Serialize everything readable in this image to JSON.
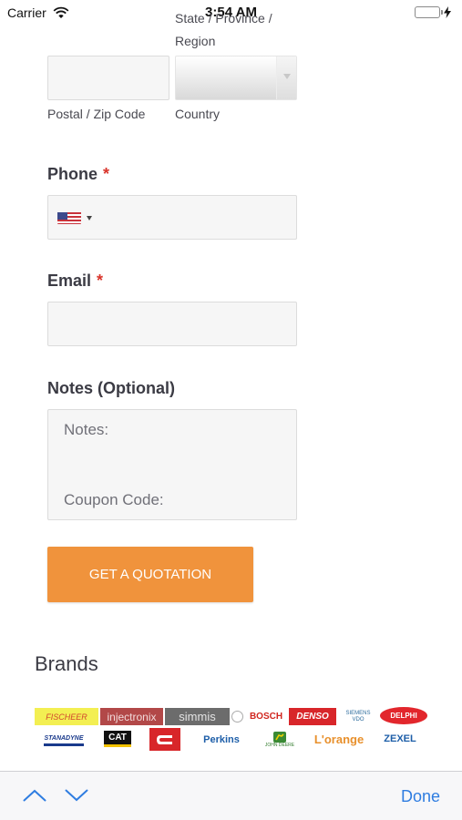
{
  "status_bar": {
    "carrier": "Carrier",
    "time": "3:54 AM"
  },
  "form": {
    "state_label": "State / Province / Region",
    "postal_label": "Postal / Zip Code",
    "country_label": "Country",
    "phone_label": "Phone",
    "email_label": "Email",
    "required_mark": "*",
    "notes_label": "Notes (Optional)",
    "notes_value_line1": "Notes:",
    "notes_value_line2": "Coupon Code:",
    "submit_label": "GET A QUOTATION"
  },
  "brands": {
    "title": "Brands",
    "logos": [
      "FISCHEER",
      "injectronix",
      "simmis",
      "BOSCH",
      "DENSO",
      "SIEMENS VDO",
      "DELPHI",
      "STANADYNE",
      "CAT",
      "Perkins",
      "JOHN DEERE",
      "L'orange",
      "ZEXEL"
    ]
  },
  "toolbar": {
    "done_label": "Done"
  },
  "colors": {
    "accent": "#f0933c",
    "required": "#d9342b",
    "ios_blue": "#2f7de1"
  }
}
